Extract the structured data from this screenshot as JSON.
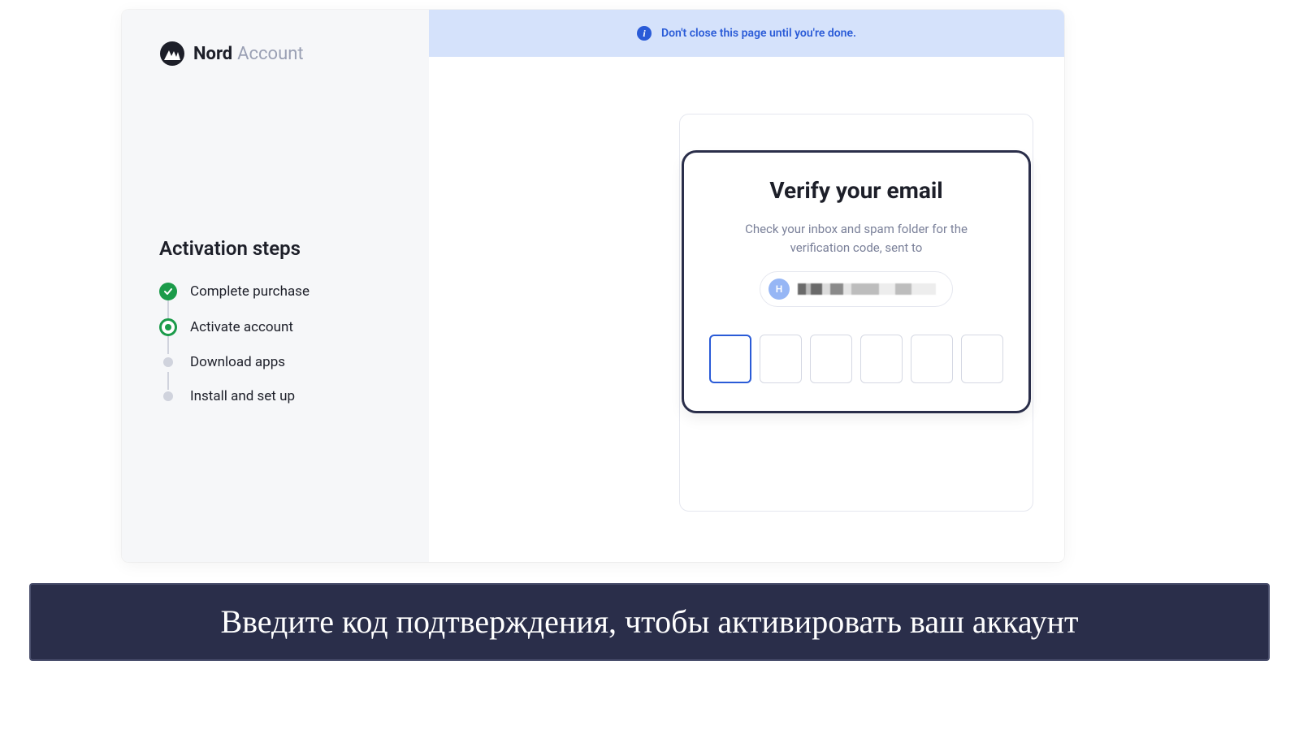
{
  "brand": {
    "name_strong": "Nord",
    "name_light": "Account"
  },
  "sidebar": {
    "title": "Activation steps",
    "steps": [
      {
        "label": "Complete purchase",
        "state": "done"
      },
      {
        "label": "Activate account",
        "state": "active"
      },
      {
        "label": "Download apps",
        "state": "pending"
      },
      {
        "label": "Install and set up",
        "state": "pending"
      }
    ]
  },
  "banner": {
    "text": "Don't close this page until you're done."
  },
  "verify": {
    "title": "Verify your email",
    "description": "Check your inbox and spam folder for the verification code, sent to",
    "avatar_initial": "H",
    "code_length": 6
  },
  "caption": {
    "text": "Введите код подтверждения, чтобы активировать ваш аккаунт"
  },
  "colors": {
    "accent_green": "#1b9b4a",
    "accent_blue": "#2a5bd7",
    "dark_navy": "#2a2e4a",
    "banner_bg": "#d5e2fb"
  }
}
